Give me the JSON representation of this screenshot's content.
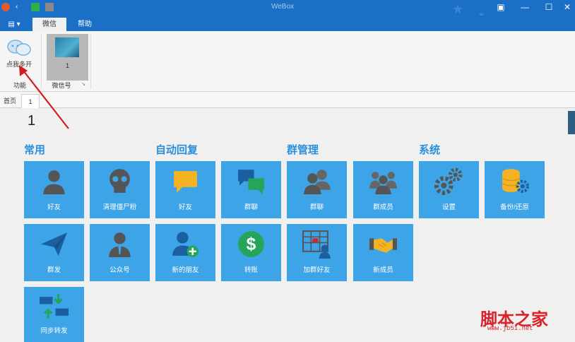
{
  "window": {
    "title": "WeBox"
  },
  "ribbon_tabs": [
    {
      "label": "微信"
    },
    {
      "label": "帮助"
    }
  ],
  "ribbon": {
    "open_label": "点我多开",
    "group1_label": "功能",
    "account_number": "1",
    "group2_label": "微信号"
  },
  "page_tabs": [
    {
      "label": "首页"
    },
    {
      "label": "1"
    }
  ],
  "page_number": "1",
  "sections": {
    "common": "常用",
    "auto_reply": "自动回复",
    "group_manage": "群管理",
    "system": "系统"
  },
  "tiles": {
    "friends": "好友",
    "clean_zombie": "清理僵尸粉",
    "auto_friends": "好友",
    "auto_group_chat": "群聊",
    "group_chat": "群聊",
    "group_members": "群成员",
    "settings": "设置",
    "backup": "备份/还原",
    "group_send": "群发",
    "official": "公众号",
    "new_friends": "新的朋友",
    "transfer": "转账",
    "add_group_friends": "加群好友",
    "new_members": "新成员",
    "sync_forward": "同步转发"
  },
  "watermark": {
    "text": "脚本之家",
    "url": "www.jb51.net"
  },
  "colors": {
    "titlebar": "#1c6fc7",
    "tile": "#3ea4e8",
    "section_title": "#2a8fdc",
    "annotation_arrow": "#d01e1e"
  }
}
